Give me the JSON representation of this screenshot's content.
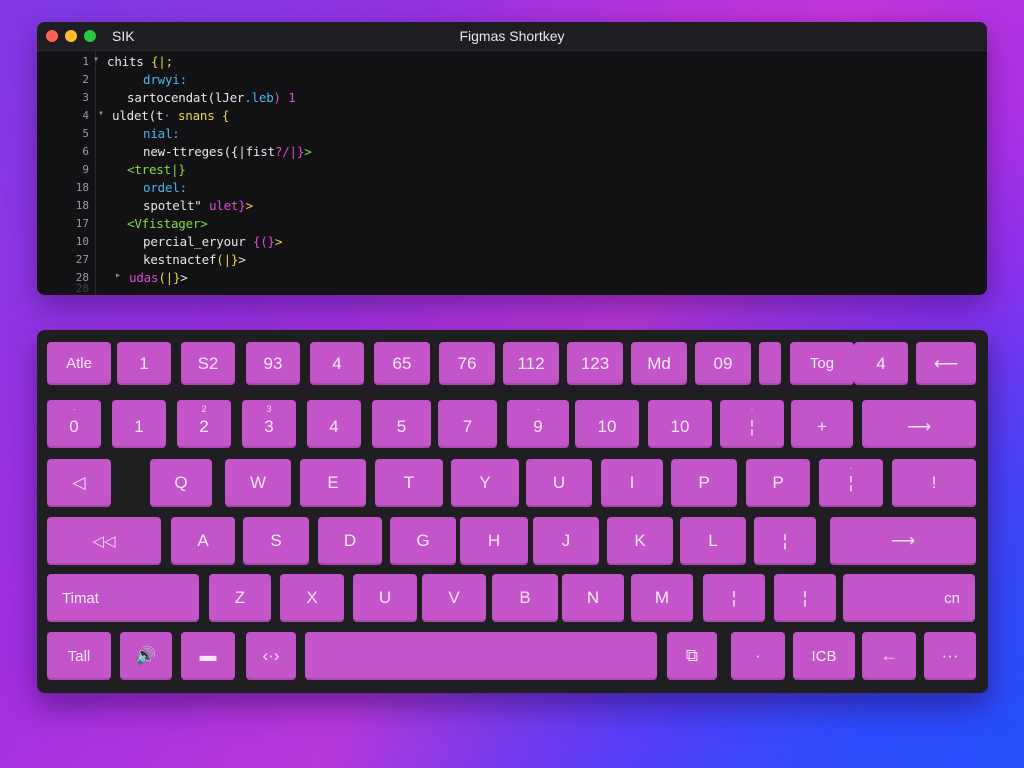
{
  "window": {
    "app_name": "SIK",
    "title": "Figmas Shortkey"
  },
  "code": {
    "lines": [
      {
        "n": "1",
        "fold": "▾",
        "parts": [
          {
            "t": "chits ",
            "c": "white"
          },
          {
            "t": "{|;",
            "c": "yellow"
          }
        ]
      },
      {
        "n": "2",
        "parts": [
          {
            "t": "drwyi:",
            "c": "cyan"
          }
        ]
      },
      {
        "n": "3",
        "parts": [
          {
            "t": "sartocendat",
            "c": "white"
          },
          {
            "t": "(lJer",
            "c": "white"
          },
          {
            "t": ".leb",
            "c": "cyan"
          },
          {
            "t": ") 1",
            "c": "pink"
          }
        ]
      },
      {
        "n": "4",
        "fold": "▾",
        "parts": [
          {
            "t": "uldet(t",
            "c": "white"
          },
          {
            "t": "· ",
            "c": "pink"
          },
          {
            "t": "snans {",
            "c": "yellow"
          }
        ]
      },
      {
        "n": "5",
        "parts": [
          {
            "t": "nial:",
            "c": "cyan"
          }
        ]
      },
      {
        "n": "6",
        "parts": [
          {
            "t": "new-ttreges",
            "c": "white"
          },
          {
            "t": "({|fist",
            "c": "white"
          },
          {
            "t": "?/|}",
            "c": "pink"
          },
          {
            "t": ">",
            "c": "green"
          }
        ]
      },
      {
        "n": "9",
        "parts": [
          {
            "t": "<trest|}",
            "c": "green"
          }
        ]
      },
      {
        "n": "18",
        "parts": [
          {
            "t": "ordel:",
            "c": "cyan"
          }
        ]
      },
      {
        "n": "18",
        "parts": [
          {
            "t": "spotelt\" ",
            "c": "white"
          },
          {
            "t": "ulet}",
            "c": "pink"
          },
          {
            "t": ">",
            "c": "yellow"
          }
        ]
      },
      {
        "n": "17",
        "parts": [
          {
            "t": "<Vfistager>",
            "c": "green"
          }
        ]
      },
      {
        "n": "10",
        "parts": [
          {
            "t": "percial_eryour ",
            "c": "white"
          },
          {
            "t": "{(}",
            "c": "pink"
          },
          {
            "t": ">",
            "c": "yellow"
          }
        ]
      },
      {
        "n": "27",
        "parts": [
          {
            "t": "kestnactef",
            "c": "white"
          },
          {
            "t": "(|}",
            "c": "yellow"
          },
          {
            "t": ">",
            "c": "white"
          }
        ]
      },
      {
        "n": "28",
        "fold": "▸",
        "parts": [
          {
            "t": "udas",
            "c": "pink"
          },
          {
            "t": "(|}",
            "c": "yellow"
          },
          {
            "t": ">",
            "c": "white"
          }
        ]
      },
      {
        "n": "28",
        "parts": []
      }
    ]
  },
  "keyboard": {
    "rows": [
      [
        "Atle",
        "1",
        "S2",
        "93",
        "4",
        "65",
        "76",
        "112",
        "123",
        "Md",
        "09",
        "",
        "Tog",
        "4",
        "⟵"
      ],
      [
        "0",
        "1",
        "2",
        "3",
        "4",
        "5",
        "7",
        "9",
        "10",
        "10",
        "¦",
        "+",
        "⟶"
      ],
      [
        "◁",
        "Q",
        "W",
        "E",
        "T",
        "Y",
        "U",
        "I",
        "P",
        "P",
        "¦",
        "!"
      ],
      [
        "◁◁",
        "A",
        "S",
        "D",
        "G",
        "H",
        "J",
        "K",
        "L",
        "¦",
        "⟶"
      ],
      [
        "Timat",
        "Z",
        "X",
        "U",
        "V",
        "B",
        "N",
        "M",
        "¦",
        "¦",
        "cn"
      ],
      [
        "Tall",
        "🔊",
        "▬",
        "‹·›",
        "",
        "⧉",
        "·",
        "ICB",
        "←",
        "···"
      ]
    ],
    "superscripts": {
      "r1_0": "·",
      "r1_2": "2",
      "r1_3": "3",
      "r1_7": "·",
      "r1_10": "·",
      "r2_10": "·"
    }
  },
  "colors": {
    "key": "#c454c9",
    "keyboard_bg": "#1f1f22",
    "window_bg": "#121214"
  }
}
